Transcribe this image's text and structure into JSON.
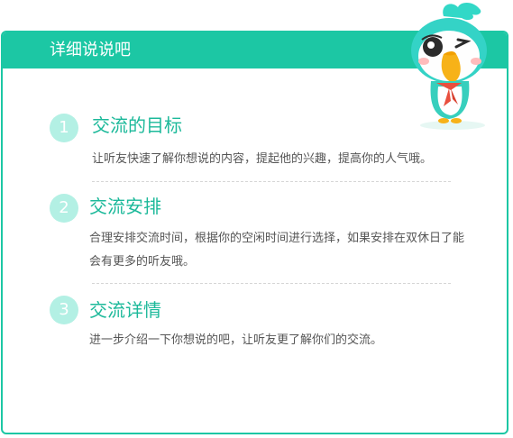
{
  "header": {
    "title": "详细说说吧"
  },
  "sections": [
    {
      "number": "1",
      "title": "交流的目标",
      "desc": "让听友快速了解你想说的内容，提起他的兴趣，提高你的人气哦。"
    },
    {
      "number": "2",
      "title": "交流安排",
      "desc": "合理安排交流时间，根据你的空闲时间进行选择，如果安排在双休日了能会有更多的听友哦。"
    },
    {
      "number": "3",
      "title": "交流详情",
      "desc": "进一步介绍一下你想说的吧，让听友更了解你们的交流。"
    }
  ],
  "mascot": {
    "icon": "parrot-mascot-icon"
  },
  "colors": {
    "accent": "#1cc7a4",
    "accent_text": "#1cb99a",
    "circle": "#b3f0e4",
    "body_text": "#555555"
  }
}
